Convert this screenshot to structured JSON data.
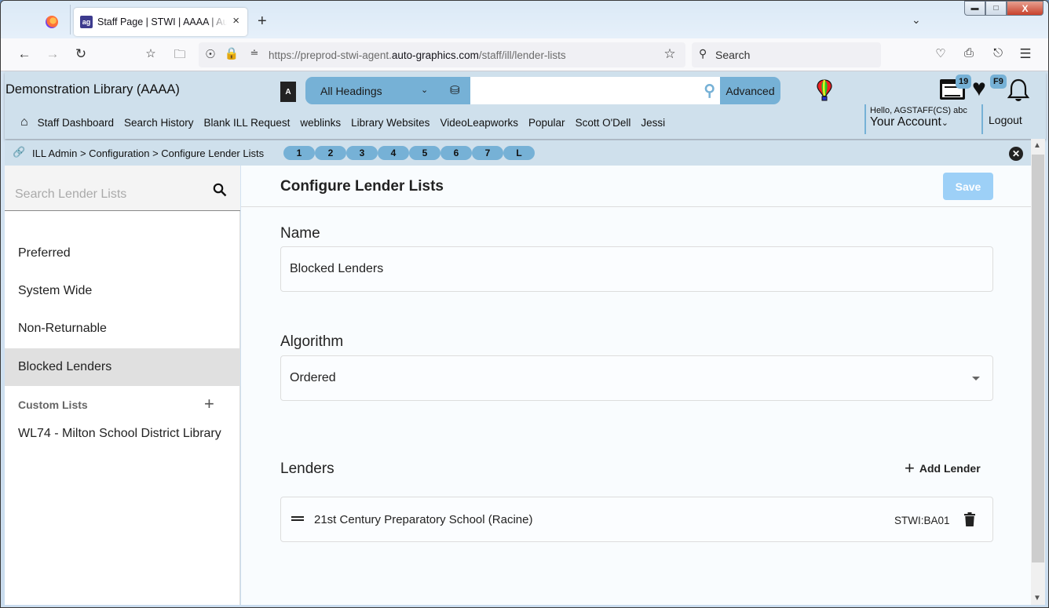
{
  "browser": {
    "tab_title": "Staff Page | STWI | AAAA | Auto-Graphics",
    "url_prefix": "https://preprod-stwi-agent.",
    "url_domain": "auto-graphics.com",
    "url_path": "/staff/ill/lender-lists",
    "search_placeholder": "Search",
    "new_tab": "+",
    "close_tab": "×"
  },
  "header": {
    "library_name": "Demonstration Library (AAAA)",
    "search_scope": "All Headings",
    "search_value": "",
    "advanced_label": "Advanced",
    "menu": [
      "Staff Dashboard",
      "Search History",
      "Blank ILL Request",
      "weblinks",
      "Library Websites",
      "VideoLeapworks",
      "Popular",
      "Scott O'Dell",
      "Jessi"
    ],
    "list_badge": "19",
    "favorites_badge": "F9",
    "greeting": "Hello, AGSTAFF(CS) abc",
    "account_label": "Your Account",
    "logout_label": "Logout"
  },
  "breadcrumb": {
    "path": "ILL Admin > Configuration > Configure Lender Lists",
    "pages": [
      "1",
      "2",
      "3",
      "4",
      "5",
      "6",
      "7",
      "L"
    ]
  },
  "sidebar": {
    "search_placeholder": "Search Lender Lists",
    "items": [
      {
        "label": "Preferred",
        "active": false
      },
      {
        "label": "System Wide",
        "active": false
      },
      {
        "label": "Non-Returnable",
        "active": false
      },
      {
        "label": "Blocked Lenders",
        "active": true
      }
    ],
    "custom_lists_label": "Custom Lists",
    "custom_lists": [
      "WL74 - Milton School District Library"
    ]
  },
  "main": {
    "title": "Configure Lender Lists",
    "save_label": "Save",
    "name_label": "Name",
    "name_value": "Blocked Lenders",
    "algorithm_label": "Algorithm",
    "algorithm_value": "Ordered",
    "lenders_label": "Lenders",
    "add_lender_label": "Add Lender",
    "lenders": [
      {
        "name": "21st Century Preparatory School (Racine)",
        "code": "STWI:BA01"
      }
    ]
  },
  "colors": {
    "header_bg": "#cfe0ec",
    "accent": "#76b1d6",
    "save_disabled": "#9dd0f7"
  }
}
